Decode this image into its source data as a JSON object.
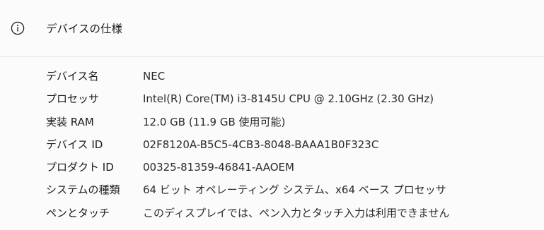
{
  "header": {
    "icon": "info-icon",
    "title": "デバイスの仕様"
  },
  "specs": [
    {
      "label": "デバイス名",
      "value": "NEC"
    },
    {
      "label": "プロセッサ",
      "value": "Intel(R) Core(TM) i3-8145U CPU @ 2.10GHz (2.30 GHz)"
    },
    {
      "label": "実装 RAM",
      "value": "12.0 GB (11.9 GB 使用可能)"
    },
    {
      "label": "デバイス ID",
      "value": "02F8120A-B5C5-4CB3-8048-BAAA1B0F323C"
    },
    {
      "label": "プロダクト ID",
      "value": "00325-81359-46841-AAOEM"
    },
    {
      "label": "システムの種類",
      "value": "64 ビット オペレーティング システム、x64 ベース プロセッサ"
    },
    {
      "label": "ペンとタッチ",
      "value": "このディスプレイでは、ペン入力とタッチ入力は利用できません"
    }
  ],
  "colors": {
    "background": "#fbfbfb",
    "divider": "#e2e2e2",
    "text": "#1b1b1b"
  }
}
